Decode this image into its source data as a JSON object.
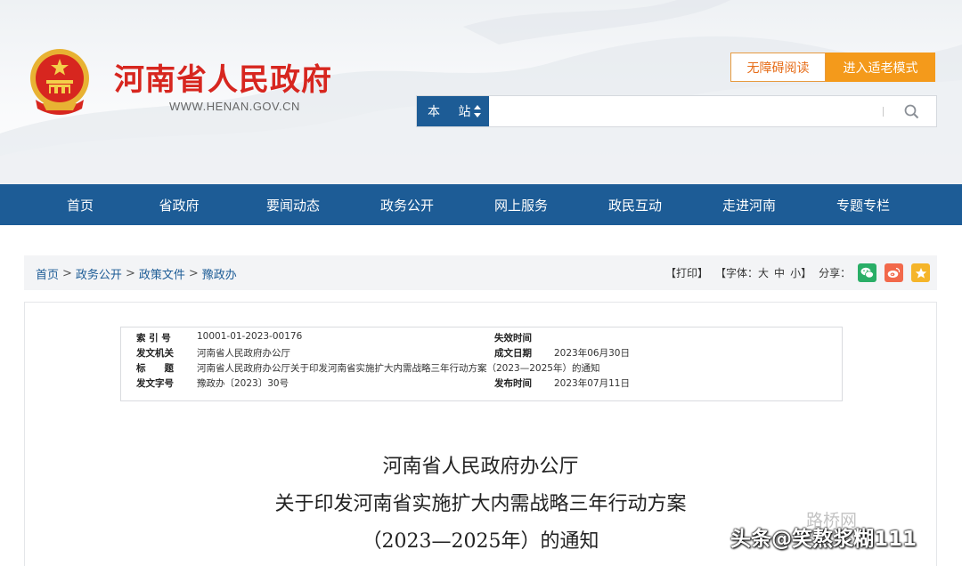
{
  "header": {
    "site_title": "河南省人民政府",
    "site_url": "WWW.HENAN.GOV.CN",
    "accessibility_label": "无障碍阅读",
    "elder_mode_label": "进入适老模式",
    "search_scope": "本 站",
    "search_placeholder": ""
  },
  "nav": {
    "items": [
      "首页",
      "省政府",
      "要闻动态",
      "政务公开",
      "网上服务",
      "政民互动",
      "走进河南",
      "专题专栏"
    ]
  },
  "breadcrumb": {
    "items": [
      "首页",
      "政务公开",
      "政策文件",
      "豫政办"
    ],
    "separator": ">"
  },
  "tools": {
    "print": "【打印】",
    "font_label": "【字体：",
    "font_large": "大",
    "font_medium": "中",
    "font_small": "小",
    "font_close": "】",
    "share_label": "分享："
  },
  "share_icons": [
    "wechat-icon",
    "weibo-icon",
    "favorite-star-icon"
  ],
  "meta": {
    "index_label": "索 引 号",
    "index_value": "10001-01-2023-00176",
    "expire_label": "失效时间",
    "expire_value": "",
    "issuer_label": "发文机关",
    "issuer_value": "河南省人民政府办公厅",
    "created_label": "成文日期",
    "created_value": "2023年06月30日",
    "title_label": "标　　题",
    "title_value": "河南省人民政府办公厅关于印发河南省实施扩大内需战略三年行动方案（2023—2025年）的通知",
    "docno_label": "发文字号",
    "docno_value": "豫政办〔2023〕30号",
    "published_label": "发布时间",
    "published_value": "2023年07月11日"
  },
  "document": {
    "title_line1": "河南省人民政府办公厅",
    "title_line2": "关于印发河南省实施扩大内需战略三年行动方案",
    "title_line3": "（2023—2025年）的通知"
  },
  "watermark": {
    "text": "头条@笑熬浆糊111",
    "faded_text": "路桥网"
  },
  "colors": {
    "brand_red": "#d7261f",
    "nav_blue": "#1d5c96",
    "accent_orange": "#f49a1b",
    "wechat_green": "#2aae67",
    "weibo_orange": "#f2694b",
    "star_yellow": "#f5b52a"
  }
}
